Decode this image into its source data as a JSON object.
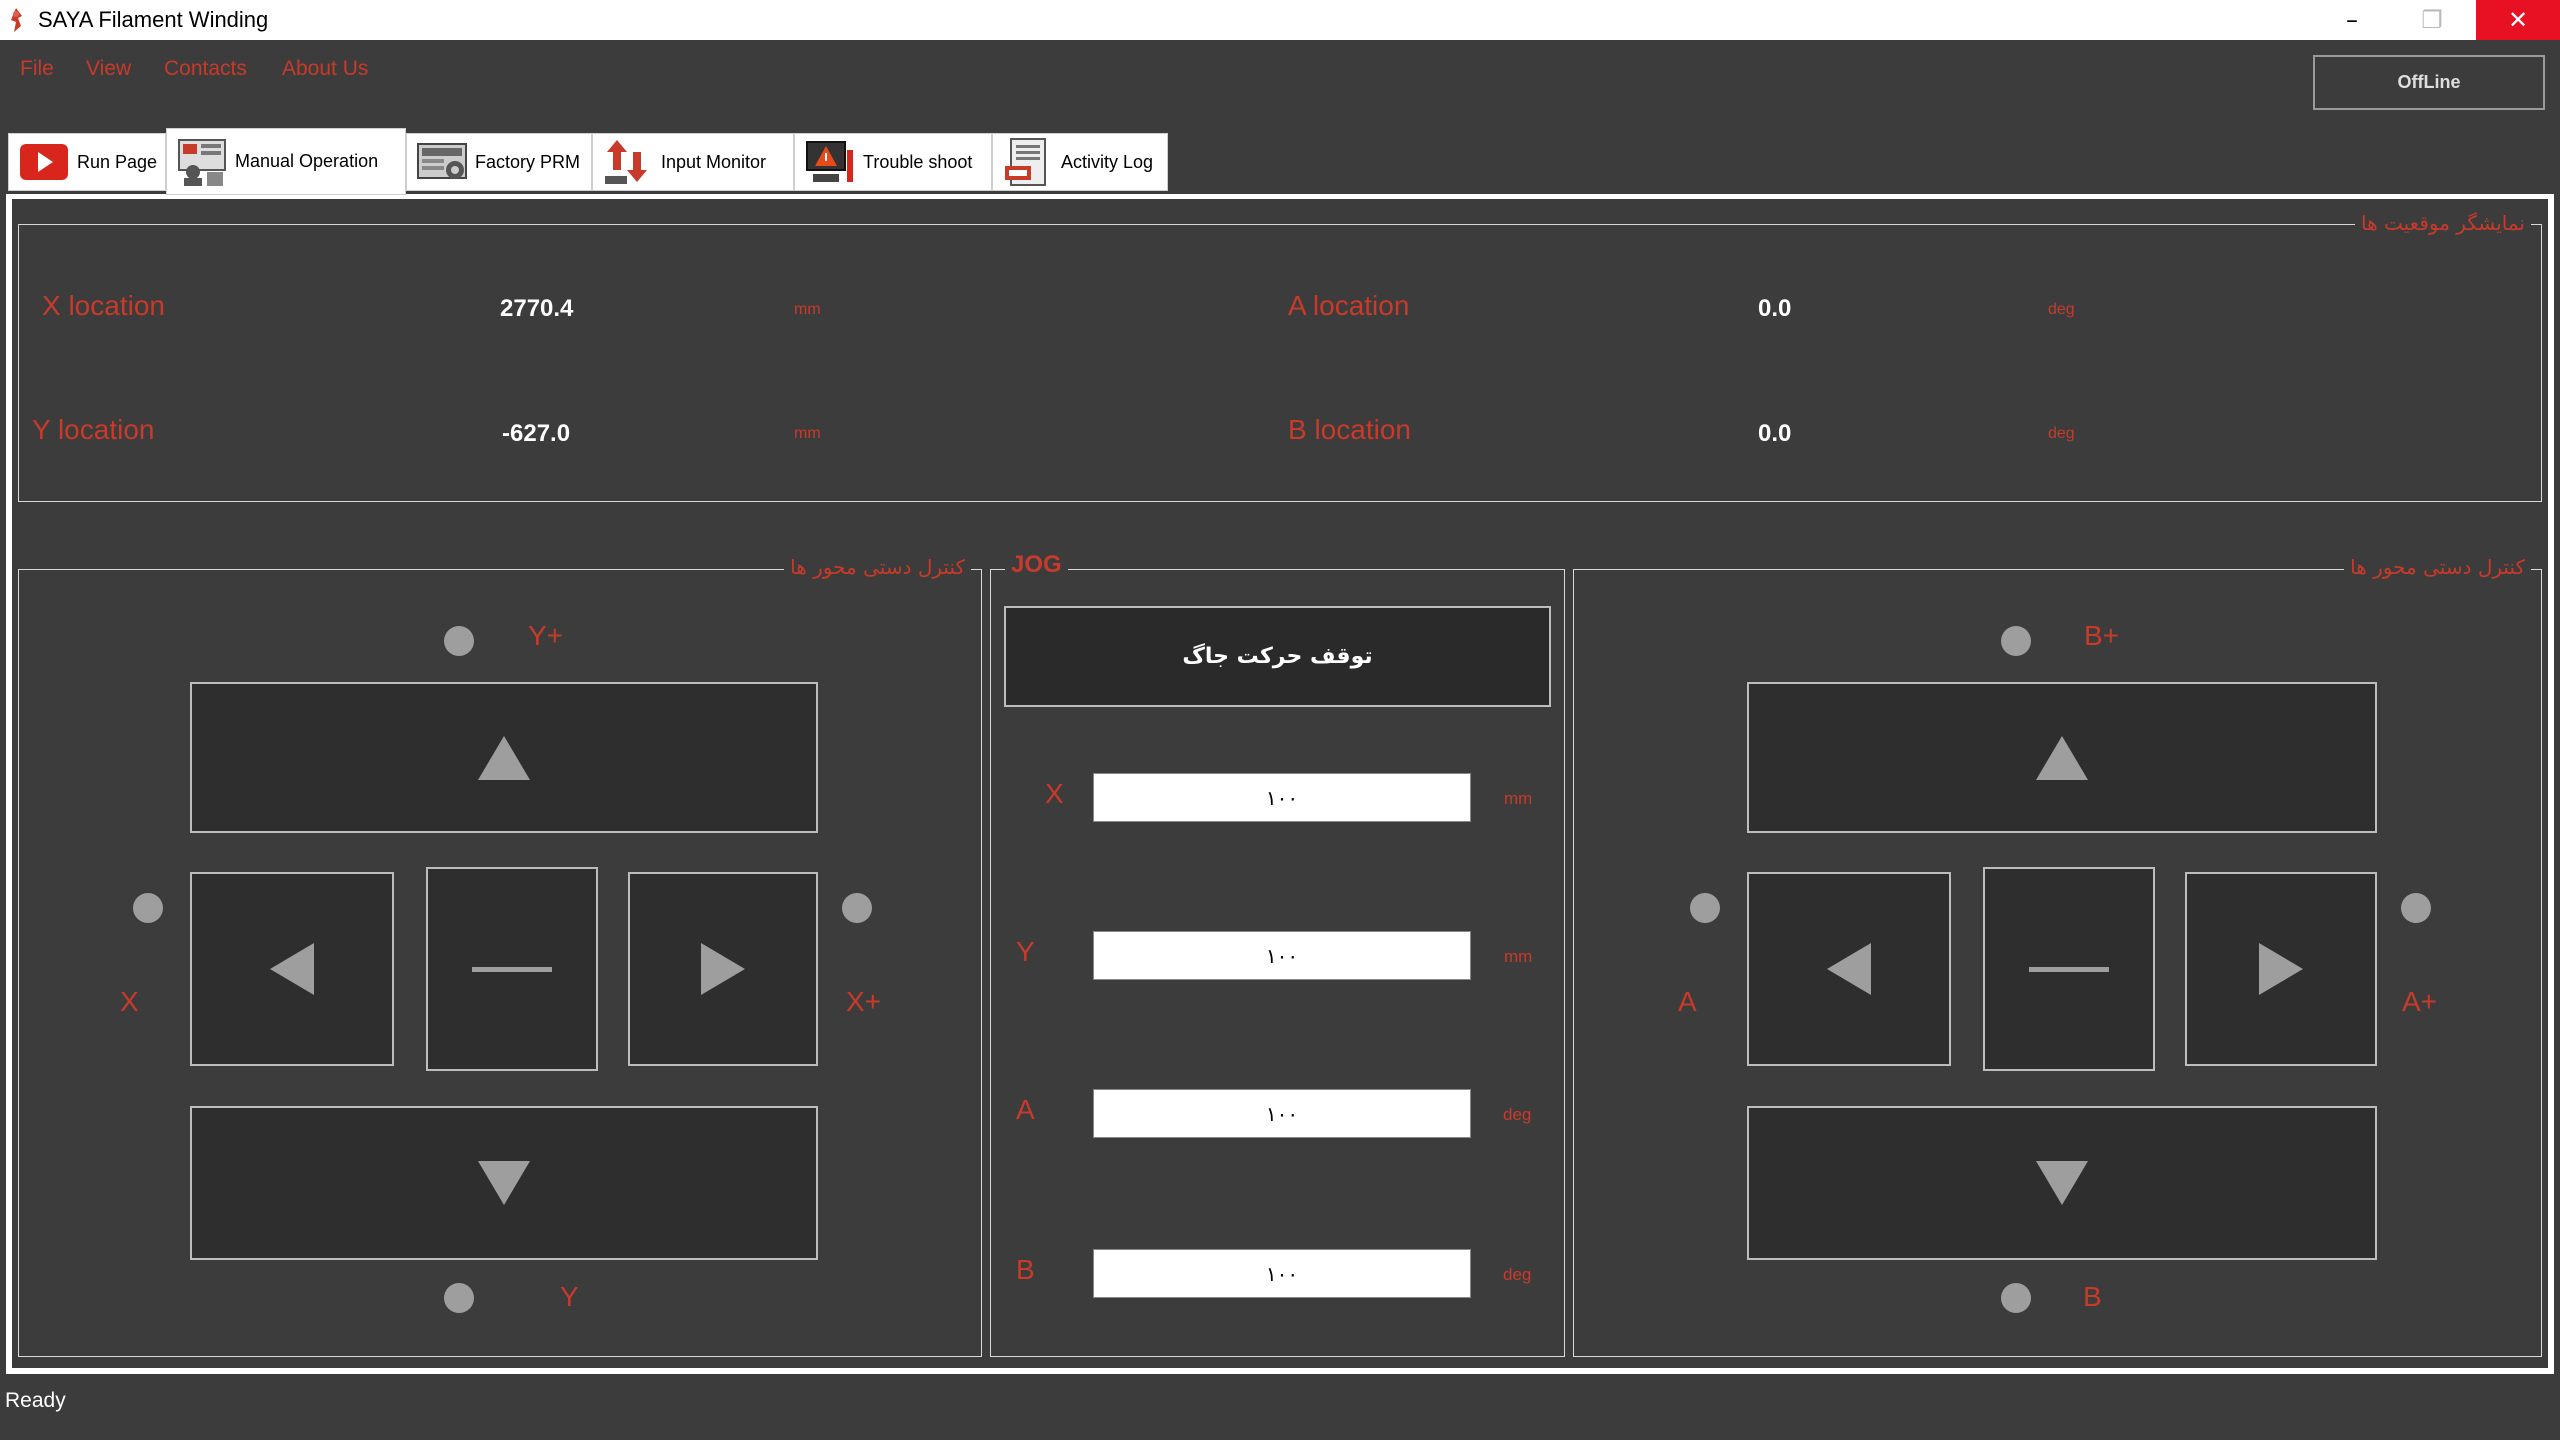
{
  "window": {
    "title": "SAYA Filament Winding",
    "minimize_glyph": "–",
    "maximize_glyph": "❐",
    "close_glyph": "✕"
  },
  "menu": {
    "file": "File",
    "view": "View",
    "contacts": "Contacts",
    "about": "About Us"
  },
  "connection_status": "OffLine",
  "tabs": {
    "run": {
      "label": "Run Page",
      "icon": "play-icon"
    },
    "manual": {
      "label": "Manual Operation",
      "icon": "manual-operator-icon"
    },
    "factory": {
      "label": "Factory PRM",
      "icon": "factory-settings-icon"
    },
    "input": {
      "label": "Input Monitor",
      "icon": "io-arrows-icon"
    },
    "trouble": {
      "label": "Trouble shoot",
      "icon": "alarm-computer-icon"
    },
    "log": {
      "label": "Activity Log",
      "icon": "log-document-icon"
    }
  },
  "position_group": {
    "title": "نمایشگر موقعیت ها",
    "x": {
      "label": "X location",
      "value": "2770.4",
      "unit": "mm"
    },
    "y": {
      "label": "Y location",
      "value": "-627.0",
      "unit": "mm"
    },
    "a": {
      "label": "A location",
      "value": "0.0",
      "unit": "deg"
    },
    "b": {
      "label": "B location",
      "value": "0.0",
      "unit": "deg"
    }
  },
  "xy_group": {
    "title": "کنترل دستی محور ها",
    "y_plus": "Y+",
    "y_minus": "Y",
    "x_minus": "X",
    "x_plus": "X+"
  },
  "ab_group": {
    "title": "کنترل دستی محور ها",
    "b_plus": "B+",
    "b_minus": "B",
    "a_minus": "A",
    "a_plus": "A+"
  },
  "jog": {
    "title": "JOG",
    "stop_label": "توقف حرکت جاگ",
    "x": {
      "label": "X",
      "value": "۱۰۰",
      "unit": "mm"
    },
    "y": {
      "label": "Y",
      "value": "۱۰۰",
      "unit": "mm"
    },
    "a": {
      "label": "A",
      "value": "۱۰۰",
      "unit": "deg"
    },
    "b": {
      "label": "B",
      "value": "۱۰۰",
      "unit": "deg"
    }
  },
  "statusbar": {
    "text": "Ready"
  },
  "colors": {
    "accent_red": "#c83a2a",
    "background": "#3c3c3c",
    "button_bg": "#2e2e2e",
    "close_red": "#e81123"
  }
}
